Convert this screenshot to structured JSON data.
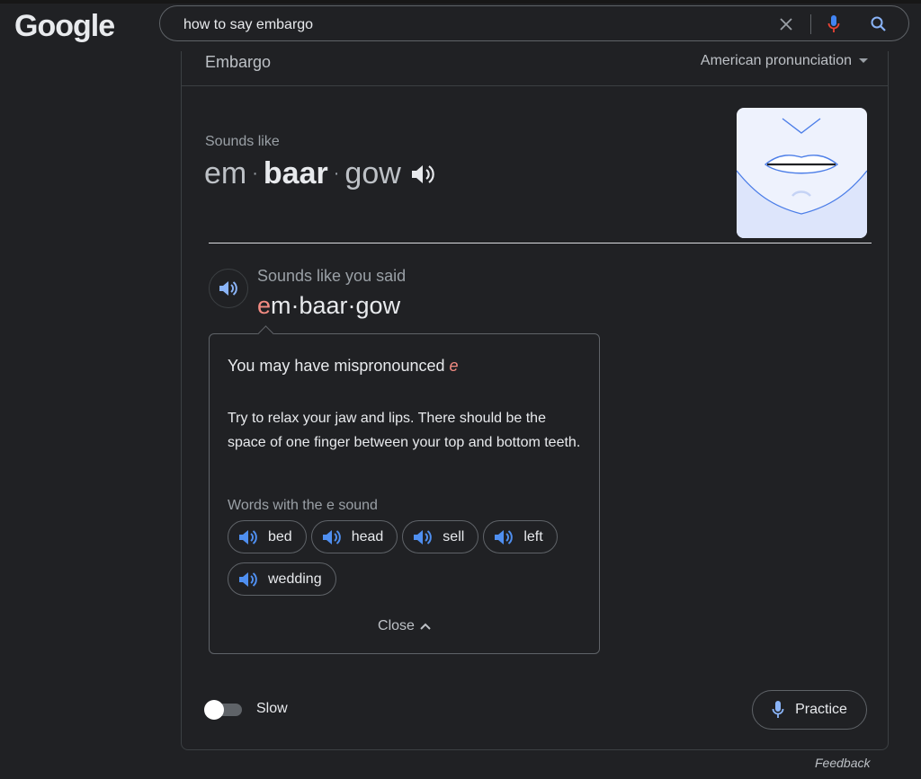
{
  "header": {
    "logo": "Google",
    "search_value": "how to say embargo"
  },
  "card": {
    "word": "Embargo",
    "accent": "American pronunciation",
    "sounds_like_label": "Sounds like",
    "syllables": [
      "em",
      "baar",
      "gow"
    ],
    "separator": "·"
  },
  "attempt": {
    "label": "Sounds like you said",
    "error_part": "e",
    "rest_part": "m·baar·gow"
  },
  "popup": {
    "title": "You may have mispronounced",
    "title_letter": "e",
    "body": "Try to relax your jaw and lips. There should be the space of one finger between your top and bottom teeth.",
    "words_label": "Words with the e sound",
    "words": [
      "bed",
      "head",
      "sell",
      "left",
      "wedding"
    ],
    "close_label": "Close"
  },
  "controls": {
    "slow_label": "Slow",
    "practice_label": "Practice"
  },
  "footer": {
    "feedback": "Feedback"
  },
  "colors": {
    "background": "#202124",
    "error": "#f28b82",
    "speaker_blue": "#8ab4f8",
    "mic_blue": "#4285f4",
    "mic_red": "#ea4335"
  }
}
